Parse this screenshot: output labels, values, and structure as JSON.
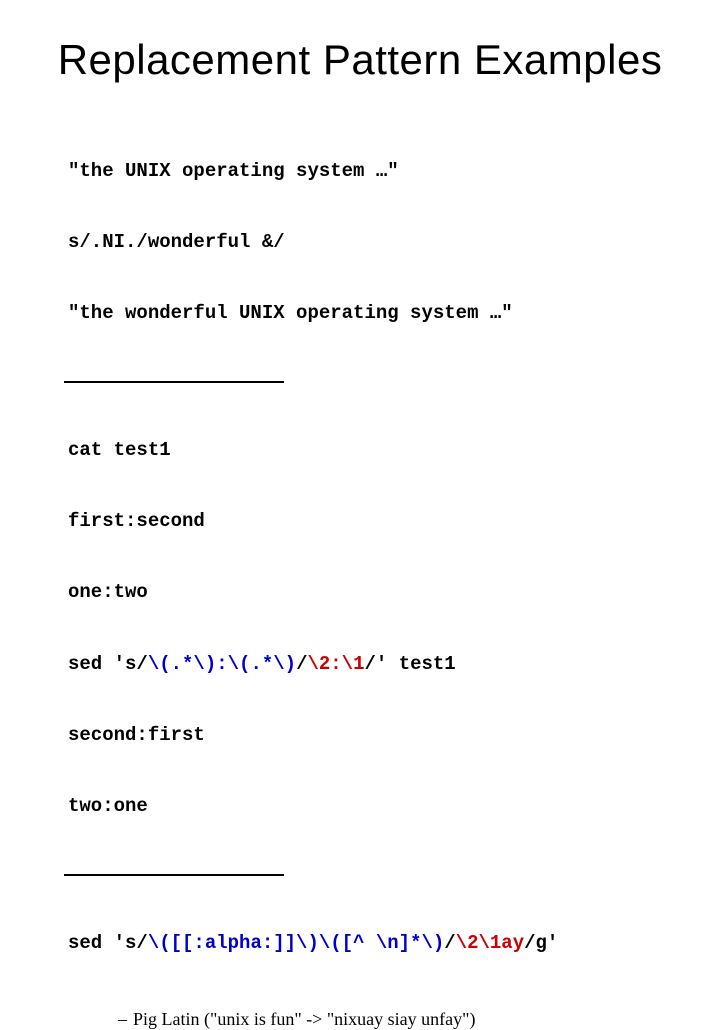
{
  "title": "Replacement Pattern Examples",
  "block1": {
    "l1": "\"the UNIX operating system …\"",
    "l2": "s/.NI./wonderful &/",
    "l3": "\"the wonderful UNIX operating system …\""
  },
  "block2": {
    "l1": "cat test1",
    "l2": "first:second",
    "l3": "one:two",
    "l4a": "sed 's/",
    "l4b": "\\(.*\\):\\(.*\\)",
    "l4c": "/",
    "l4d": "\\2:\\1",
    "l4e": "/' test1",
    "l5": "second:first",
    "l6": "two:one"
  },
  "block3": {
    "a": "sed 's/",
    "b": "\\([[:alpha:]]\\)\\([^ \\n]*\\)",
    "c": "/",
    "d": "\\2\\1ay",
    "e": "/g'"
  },
  "note": {
    "dash": "–",
    "text": "Pig Latin (\"unix is fun\" -> \"nixuay siay unfay\")"
  }
}
